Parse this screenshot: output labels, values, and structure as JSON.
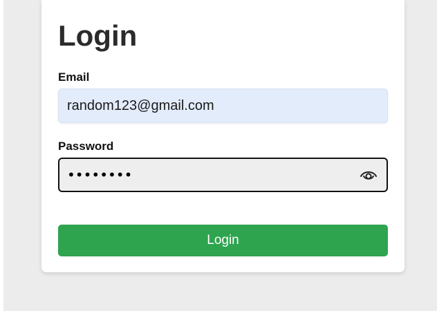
{
  "login_form": {
    "title": "Login",
    "email": {
      "label": "Email",
      "value": "random123@gmail.com"
    },
    "password": {
      "label": "Password",
      "value": "••••••••",
      "toggle_icon": "eye-icon"
    },
    "submit_label": "Login"
  },
  "colors": {
    "page_background": "#ececec",
    "card_background": "#ffffff",
    "email_field_background": "#e3ecfb",
    "password_field_background": "#eeeeee",
    "button_background": "#2ea44f",
    "button_text": "#ffffff"
  }
}
